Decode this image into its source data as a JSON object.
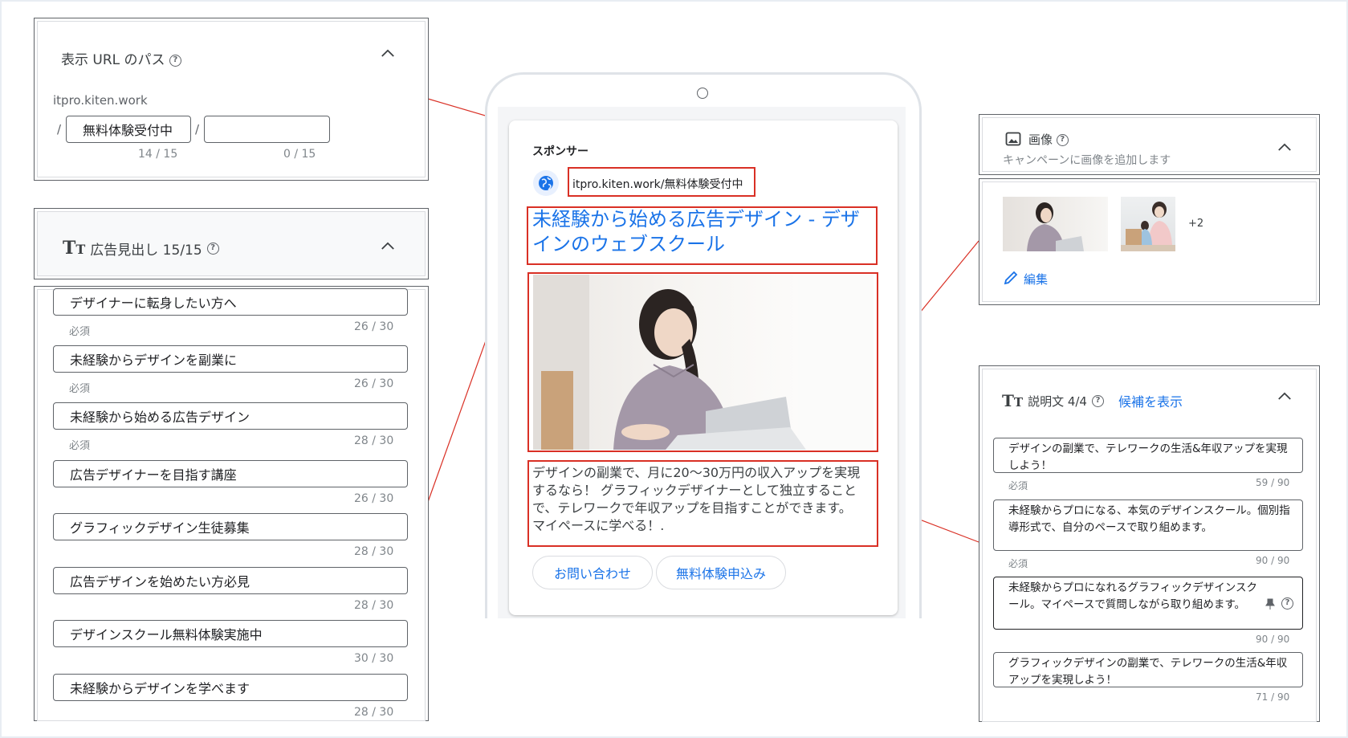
{
  "url_panel": {
    "title": "表示 URL のパス",
    "domain": "itpro.kiten.work",
    "slash": "/",
    "path1_value": "無料体験受付中",
    "path2_value": "",
    "path1_count": "14 / 15",
    "path2_count": "0 / 15"
  },
  "headline_panel": {
    "title": "広告見出し 15/15",
    "items": [
      {
        "text": "デザイナーに転身したい方へ",
        "required": "必須",
        "count": "26 / 30"
      },
      {
        "text": "未経験からデザインを副業に",
        "required": "必須",
        "count": "26 / 30"
      },
      {
        "text": "未経験から始める広告デザイン",
        "required": "必須",
        "count": "28 / 30"
      },
      {
        "text": "広告デザイナーを目指す講座",
        "required": "",
        "count": "26 / 30"
      },
      {
        "text": "グラフィックデザイン生徒募集",
        "required": "",
        "count": "28 / 30"
      },
      {
        "text": "広告デザインを始めたい方必見",
        "required": "",
        "count": "28 / 30"
      },
      {
        "text": "デザインスクール無料体験実施中",
        "required": "",
        "count": "30 / 30"
      },
      {
        "text": "未経験からデザインを学べます",
        "required": "",
        "count": "28 / 30"
      }
    ]
  },
  "ad_preview": {
    "sponsor": "スポンサー",
    "display_url": "itpro.kiten.work/無料体験受付中",
    "headline": "未経験から始める広告デザイン - デザインのウェブスクール",
    "description": "デザインの副業で、月に20〜30万円の収入アップを実現するなら！ グラフィックデザイナーとして独立することで、テレワークで年収アップを目指すことができます。 マイペースに学べる！.",
    "button1": "お問い合わせ",
    "button2": "無料体験申込み"
  },
  "image_panel": {
    "title": "画像",
    "subtitle": "キャンペーンに画像を追加します",
    "more": "+2",
    "edit": "編集"
  },
  "description_panel": {
    "title": "説明文 4/4",
    "suggest_link": "候補を表示",
    "items": [
      {
        "text": "デザインの副業で、テレワークの生活&年収アップを実現しよう！",
        "required": "必須",
        "count": "59 / 90"
      },
      {
        "text": "未経験からプロになる、本気のデザインスクール。個別指導形式で、自分のペースで取り組めます。",
        "required": "必須",
        "count": "90 / 90"
      },
      {
        "text": "未経験からプロになれるグラフィックデザインスクール。マイペースで質問しながら取り組めます。",
        "required": "",
        "count": "90 / 90"
      },
      {
        "text": "グラフィックデザインの副業で、テレワークの生活&年収アップを実現しよう！",
        "required": "",
        "count": "71 / 90"
      }
    ]
  },
  "colors": {
    "accent": "#1a73e8",
    "annotation": "#d93025",
    "text": "#3c4043"
  }
}
